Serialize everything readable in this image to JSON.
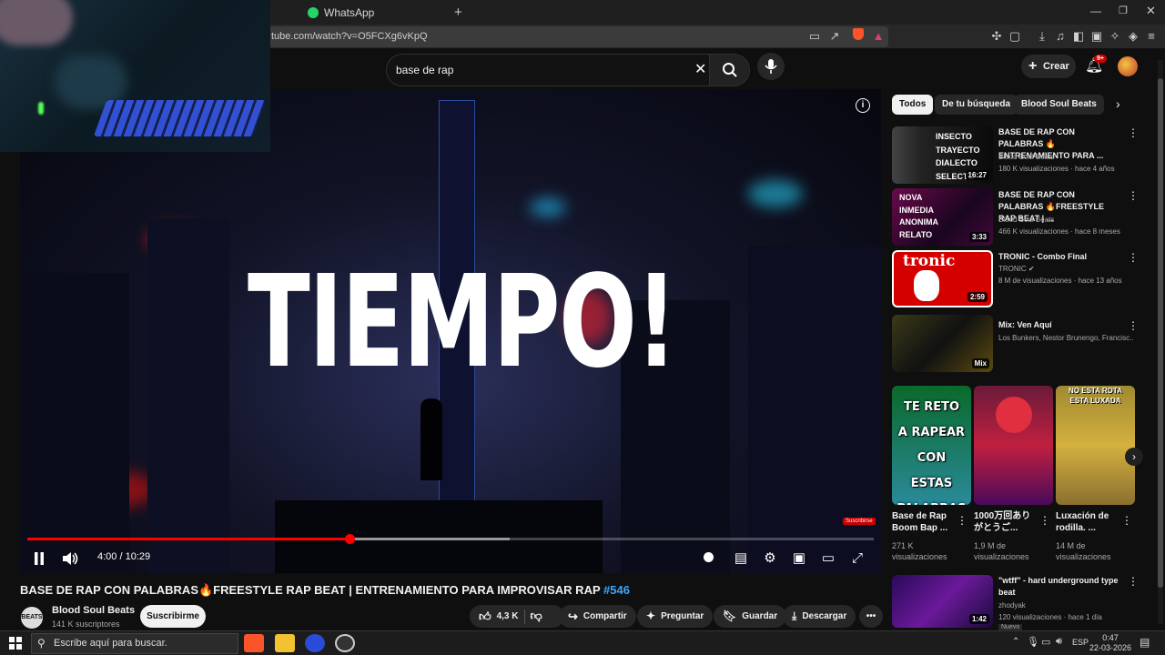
{
  "browser": {
    "tab_whatsapp": "WhatsApp",
    "url": "tube.com/watch?v=O5FCXg6vKpQ",
    "brave_badge": "10+"
  },
  "header": {
    "search_value": "base de rap",
    "create_label": "Crear",
    "notif_count": "9+"
  },
  "player": {
    "overlay_text": "TIEMPO!",
    "time": "4:00 / 10:29",
    "progress": 0.381,
    "buffer": 0.57,
    "subscribe_watermark": "Suscribirse"
  },
  "video": {
    "title": "BASE DE RAP CON PALABRAS🔥FREESTYLE RAP BEAT | ENTRENAMIENTO PARA IMPROVISAR RAP",
    "tag": "#546",
    "channel": "Blood Soul Beats",
    "channel_avatar": "BEATS",
    "subscribers": "141 K suscriptores",
    "subscribe_label": "Suscribirme",
    "likes": "4,3 K",
    "share": "Compartir",
    "ask": "Preguntar",
    "save": "Guardar",
    "download": "Descargar"
  },
  "chips": [
    "Todos",
    "De tu búsqueda",
    "Blood Soul Beats"
  ],
  "recommendations": [
    {
      "title": "BASE DE RAP CON PALABRAS 🔥ENTRENAMIENTO PARA ...",
      "channel": "Blood Soul Beats",
      "meta": "180 K visualizaciones · hace 4 años",
      "duration": "16:27",
      "thumb_text": [
        "INSECTO",
        "TRAYECTO",
        "DIALECTO",
        "SELECTO"
      ]
    },
    {
      "title": "BASE DE RAP CON PALABRAS 🔥FREESTYLE RAP BEAT | ...",
      "channel": "Blood Soul Beats",
      "meta": "466 K visualizaciones · hace 8 meses",
      "duration": "3:33",
      "thumb_text": [
        "NOVA",
        "INMEDIA",
        "ANONIMA",
        "RELATO"
      ]
    },
    {
      "title": "TRONIC - Combo Final",
      "channel": "TRONIC",
      "meta": "8 M de visualizaciones · hace 13 años",
      "duration": "2:59",
      "thumb_text": [
        "tronic"
      ]
    },
    {
      "title": "Mix: Ven Aquí",
      "channel": "Los Bunkers, Nestor Brunengo, Francisc...",
      "meta": "",
      "duration": "Mix",
      "thumb_text": []
    }
  ],
  "shorts": [
    {
      "title": "Base de Rap Boom Bap ...",
      "meta": "271 K visualizaciones",
      "caption": [
        "TE RETO",
        "A RAPEAR",
        "CON ESTAS",
        "PALABRAS"
      ]
    },
    {
      "title": "1000万回ありがとうご...",
      "meta": "1,9 M de visualizaciones",
      "caption": []
    },
    {
      "title": "Luxación de rodilla. ...",
      "meta": "14 M de visualizaciones",
      "caption": [
        "NO ESTA ROTA",
        "ESTA LUXADA"
      ]
    }
  ],
  "last_rec": {
    "title": "\"wtff\" - hard underground type beat",
    "channel": "zhodyak",
    "meta": "120 visualizaciones · hace 1 día",
    "duration": "1:42",
    "badge": "Nuevo"
  },
  "taskbar": {
    "search_placeholder": "Escribe aquí para buscar.",
    "lang": "ESP",
    "time": "0:47",
    "date": "22-03-2026"
  },
  "colors": {
    "accent_red": "#ff0000",
    "link_blue": "#3ea6ff",
    "bg": "#0f0f0f"
  }
}
